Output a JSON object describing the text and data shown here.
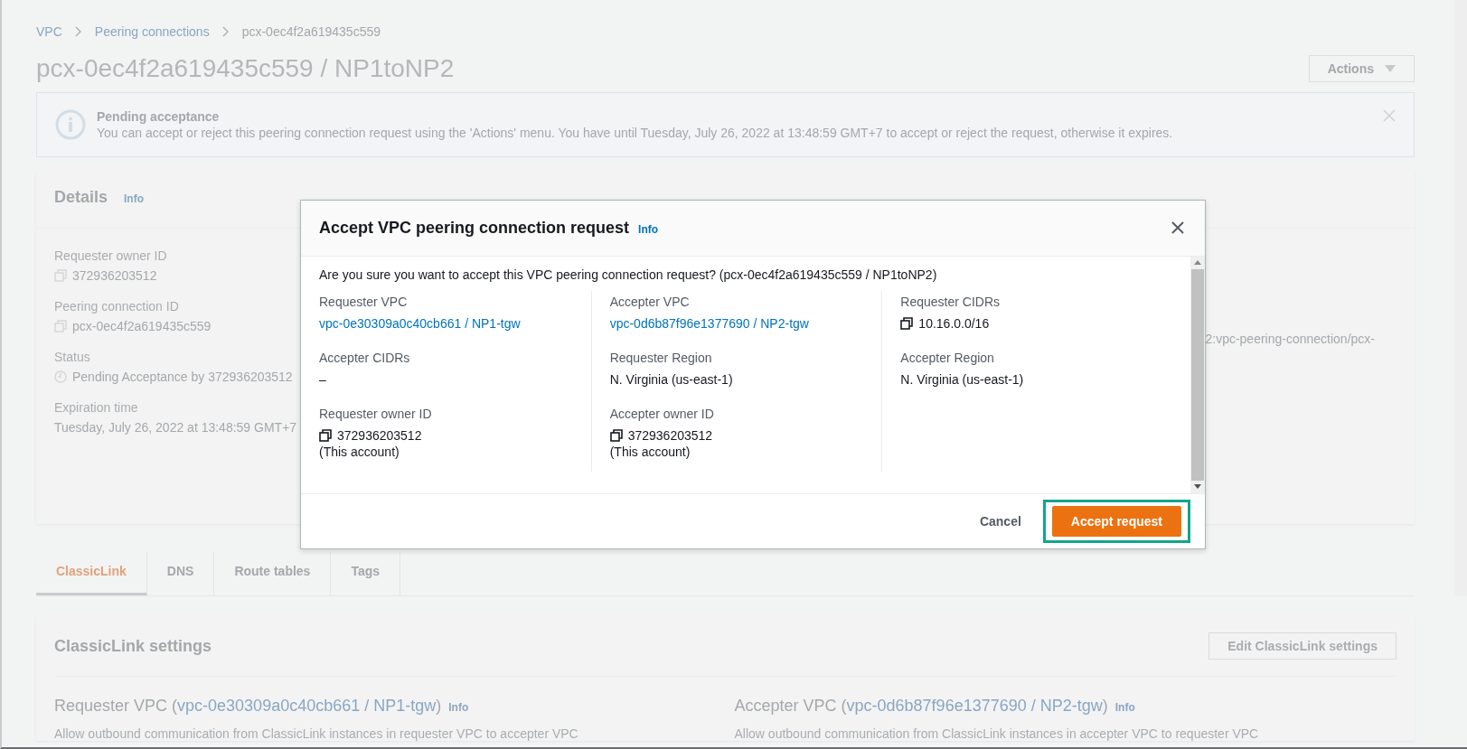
{
  "breadcrumbs": [
    {
      "label": "VPC",
      "kind": "link"
    },
    {
      "label": "Peering connections",
      "kind": "link"
    },
    {
      "label": "pcx-0ec4f2a619435c559",
      "kind": "current"
    }
  ],
  "page_title": "pcx-0ec4f2a619435c559 / NP1toNP2",
  "actions_button": "Actions",
  "alert": {
    "title": "Pending acceptance",
    "message": "You can accept or reject this peering connection request using the 'Actions' menu. You have until Tuesday, July 26, 2022 at 13:48:59 GMT+7 to accept or reject the request, otherwise it expires."
  },
  "details": {
    "title": "Details",
    "info": "Info",
    "fields": [
      {
        "label": "Requester owner ID",
        "value": "372936203512",
        "kind": "copy"
      },
      {
        "label": "Peering connection ID",
        "value": "pcx-0ec4f2a619435c559",
        "kind": "copy"
      },
      {
        "label": "Status",
        "value": "Pending Acceptance by 372936203512",
        "kind": "status"
      },
      {
        "label": "Expiration time",
        "value": "Tuesday, July 26, 2022 at 13:48:59 GMT+7",
        "kind": "plain"
      }
    ],
    "column_2_fragment": "2:vpc-peering-connection/pcx-"
  },
  "tabs": [
    {
      "label": "ClassicLink",
      "selected": true
    },
    {
      "label": "DNS",
      "selected": false
    },
    {
      "label": "Route tables",
      "selected": false
    },
    {
      "label": "Tags",
      "selected": false
    }
  ],
  "classiclink": {
    "title": "ClassicLink settings",
    "edit_button": "Edit ClassicLink settings",
    "panels": [
      {
        "prefix": "Requester VPC (",
        "link": "vpc-0e30309a0c40cb661 / NP1-tgw",
        "suffix": ")",
        "info": "Info",
        "description": "Allow outbound communication from ClassicLink instances in requester VPC to accepter VPC"
      },
      {
        "prefix": "Accepter VPC (",
        "link": "vpc-0d6b87f96e1377690 / NP2-tgw",
        "suffix": ")",
        "info": "Info",
        "description": "Allow outbound communication from ClassicLink instances in accepter VPC to requester VPC"
      }
    ]
  },
  "modal": {
    "title": "Accept VPC peering connection request",
    "info": "Info",
    "question": "Are you sure you want to accept this VPC peering connection request? (pcx-0ec4f2a619435c559 / NP1toNP2)",
    "columns": [
      [
        {
          "label": "Requester VPC",
          "value": "vpc-0e30309a0c40cb661 / NP1-tgw",
          "kind": "link"
        },
        {
          "label": "Accepter CIDRs",
          "value": "–",
          "kind": "plain"
        },
        {
          "label": "Requester owner ID",
          "value": "372936203512",
          "note": "(This account)",
          "kind": "copy"
        }
      ],
      [
        {
          "label": "Accepter VPC",
          "value": "vpc-0d6b87f96e1377690 / NP2-tgw",
          "kind": "link"
        },
        {
          "label": "Requester Region",
          "value": "N. Virginia (us-east-1)",
          "kind": "plain"
        },
        {
          "label": "Accepter owner ID",
          "value": "372936203512",
          "note": "(This account)",
          "kind": "copy"
        }
      ],
      [
        {
          "label": "Requester CIDRs",
          "value": "10.16.0.0/16",
          "kind": "copy"
        },
        {
          "label": "Accepter Region",
          "value": "N. Virginia (us-east-1)",
          "kind": "plain"
        }
      ]
    ],
    "cancel_button": "Cancel",
    "accept_button": {
      "label": "Accept request",
      "highlighted": true
    }
  }
}
